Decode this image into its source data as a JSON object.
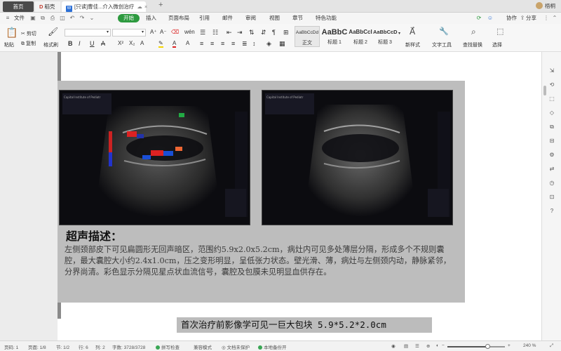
{
  "tabs": {
    "home": "首页",
    "docer": "稻壳",
    "doc": "[只读]曹佳...介入微创治疗",
    "add": "+"
  },
  "window": {
    "user": "梧桐"
  },
  "menu": {
    "items": [
      "文件",
      "开始",
      "插入",
      "页面布局",
      "引用",
      "邮件",
      "审阅",
      "视图",
      "章节",
      "特色功能"
    ],
    "active": "开始",
    "right": {
      "sync": "",
      "collab": "协作",
      "share": "分享"
    }
  },
  "ribbon": {
    "paste": "粘贴",
    "cut": "剪切",
    "copy": "复制",
    "format_painter": "格式刷",
    "styles": [
      {
        "sample": "AaBbCcDd",
        "name": "正文"
      },
      {
        "sample": "AaBbC",
        "name": "标题 1"
      },
      {
        "sample": "AaBbCcI",
        "name": "标题 2"
      },
      {
        "sample": "AaBbCcD",
        "name": "标题 3"
      }
    ],
    "new_style": "新样式",
    "text_tools": "文字工具",
    "find_replace": "查找替换",
    "select": "选择"
  },
  "document": {
    "desc_title": "超声描述：",
    "desc_body": "左侧颈部皮下可见扁圆形无回声暗区，范围约5.9x2.0x5.2cm，病灶内可见多处薄层分隔，形成多个不规则囊腔，最大囊腔大小约2.4x1.0cm，压之变形明显，呈低张力状态。壁光滑、薄，病灶与左侧颈内动，静脉紧邻，分界尚清。彩色显示分隔见星点状血流信号，囊腔及包膜未见明显血供存在。",
    "caption": "首次治疗前影像学可见一巨大包块 5.9*5.2*2.0cm",
    "us_left_header": "Capital Institute of Pediatr",
    "us_right_header": "Capital Institute of Pediatr"
  },
  "status": {
    "page_no": "页码: 1",
    "pages": "页面: 1/8",
    "section": "节: 1/2",
    "line": "行: 6",
    "col": "列: 2",
    "words": "字数: 3728/3728",
    "spell": "拼写检查",
    "compat": "兼容模式",
    "protect": "文档未保护",
    "backup": "本地备份开",
    "zoom": "240 %",
    "zoom_level": 0.7
  },
  "colors": {
    "accent": "#2d9a3f",
    "doc_icon": "#2b6fd6"
  }
}
